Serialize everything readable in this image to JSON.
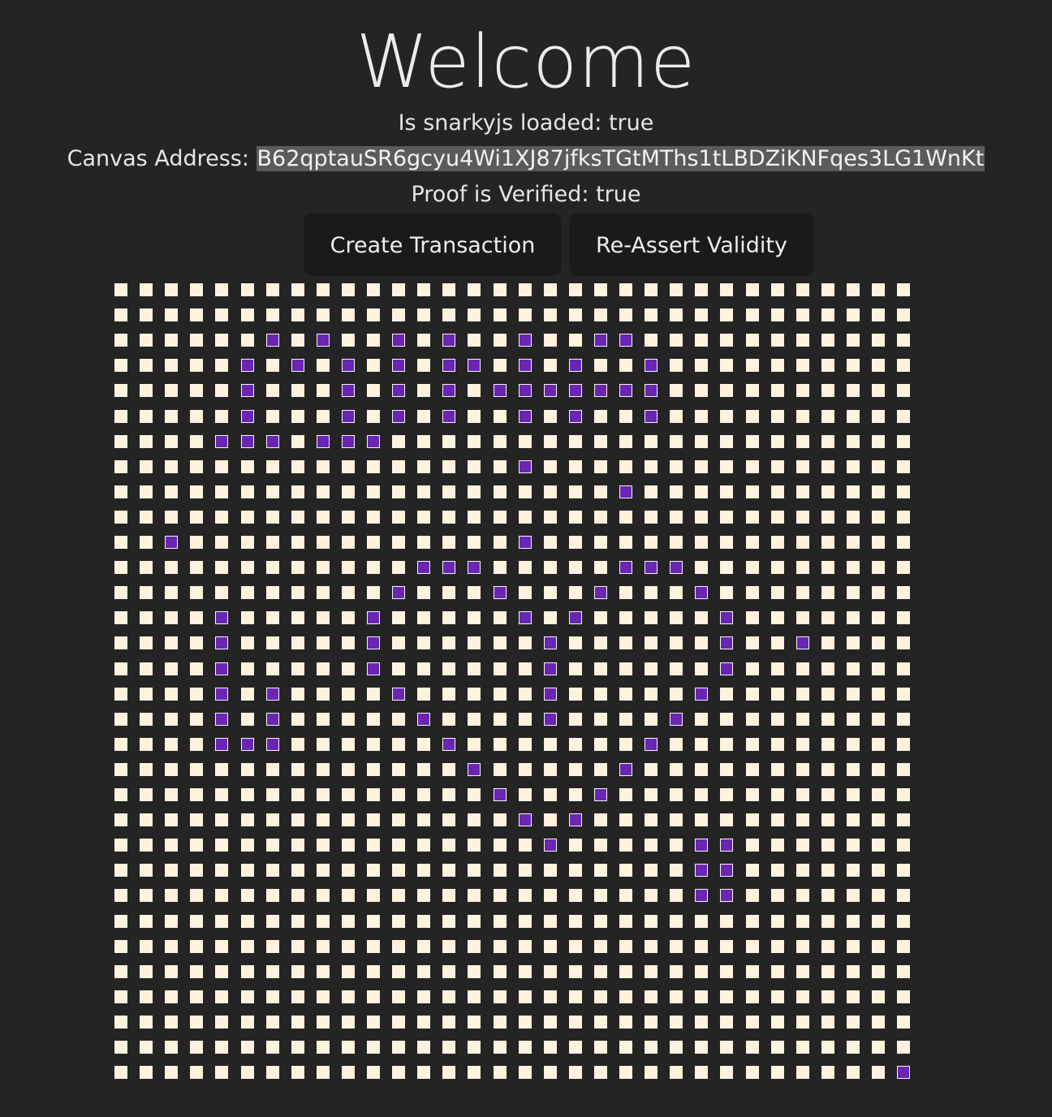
{
  "header": {
    "title": "Welcome",
    "snarky_label": "Is snarkyjs loaded: true",
    "canvas_label": "Canvas Address: ",
    "canvas_address": "B62qptauSR6gcyu4Wi1XJ87jfksTGtMThs1tLBDZiKNFqes3LG1WnKt",
    "proof_label": "Proof is Verified: true"
  },
  "buttons": {
    "create": "Create Transaction",
    "reassert": "Re-Assert Validity"
  },
  "colors": {
    "background": "#242424",
    "pixel_off": "#fff2df",
    "pixel_on": "#6a25b3",
    "button": "#1a1a1a"
  },
  "canvas": {
    "cols": 32,
    "rows": 32,
    "filled": [
      [
        2,
        6
      ],
      [
        2,
        8
      ],
      [
        2,
        11
      ],
      [
        2,
        13
      ],
      [
        2,
        16
      ],
      [
        2,
        19
      ],
      [
        2,
        20
      ],
      [
        3,
        5
      ],
      [
        3,
        7
      ],
      [
        3,
        9
      ],
      [
        3,
        11
      ],
      [
        3,
        13
      ],
      [
        3,
        14
      ],
      [
        3,
        16
      ],
      [
        3,
        18
      ],
      [
        3,
        21
      ],
      [
        4,
        5
      ],
      [
        4,
        9
      ],
      [
        4,
        11
      ],
      [
        4,
        13
      ],
      [
        4,
        15
      ],
      [
        4,
        16
      ],
      [
        4,
        17
      ],
      [
        4,
        18
      ],
      [
        4,
        19
      ],
      [
        4,
        20
      ],
      [
        4,
        21
      ],
      [
        5,
        5
      ],
      [
        5,
        9
      ],
      [
        5,
        11
      ],
      [
        5,
        13
      ],
      [
        5,
        16
      ],
      [
        5,
        18
      ],
      [
        5,
        21
      ],
      [
        6,
        4
      ],
      [
        6,
        5
      ],
      [
        6,
        6
      ],
      [
        6,
        8
      ],
      [
        6,
        9
      ],
      [
        6,
        10
      ],
      [
        7,
        16
      ],
      [
        8,
        20
      ],
      [
        10,
        2
      ],
      [
        10,
        16
      ],
      [
        11,
        12
      ],
      [
        11,
        13
      ],
      [
        11,
        14
      ],
      [
        11,
        20
      ],
      [
        11,
        21
      ],
      [
        11,
        22
      ],
      [
        12,
        11
      ],
      [
        12,
        15
      ],
      [
        12,
        19
      ],
      [
        12,
        23
      ],
      [
        13,
        4
      ],
      [
        13,
        10
      ],
      [
        13,
        16
      ],
      [
        13,
        18
      ],
      [
        13,
        24
      ],
      [
        14,
        4
      ],
      [
        14,
        10
      ],
      [
        14,
        17
      ],
      [
        14,
        24
      ],
      [
        14,
        27
      ],
      [
        15,
        4
      ],
      [
        15,
        10
      ],
      [
        15,
        17
      ],
      [
        15,
        24
      ],
      [
        16,
        4
      ],
      [
        16,
        6
      ],
      [
        16,
        11
      ],
      [
        16,
        17
      ],
      [
        16,
        23
      ],
      [
        17,
        4
      ],
      [
        17,
        6
      ],
      [
        17,
        12
      ],
      [
        17,
        17
      ],
      [
        17,
        22
      ],
      [
        18,
        4
      ],
      [
        18,
        5
      ],
      [
        18,
        6
      ],
      [
        18,
        13
      ],
      [
        18,
        21
      ],
      [
        19,
        14
      ],
      [
        19,
        20
      ],
      [
        20,
        15
      ],
      [
        20,
        19
      ],
      [
        21,
        16
      ],
      [
        21,
        18
      ],
      [
        22,
        17
      ],
      [
        22,
        23
      ],
      [
        22,
        24
      ],
      [
        23,
        23
      ],
      [
        23,
        24
      ],
      [
        24,
        23
      ],
      [
        24,
        24
      ],
      [
        31,
        31
      ]
    ]
  }
}
